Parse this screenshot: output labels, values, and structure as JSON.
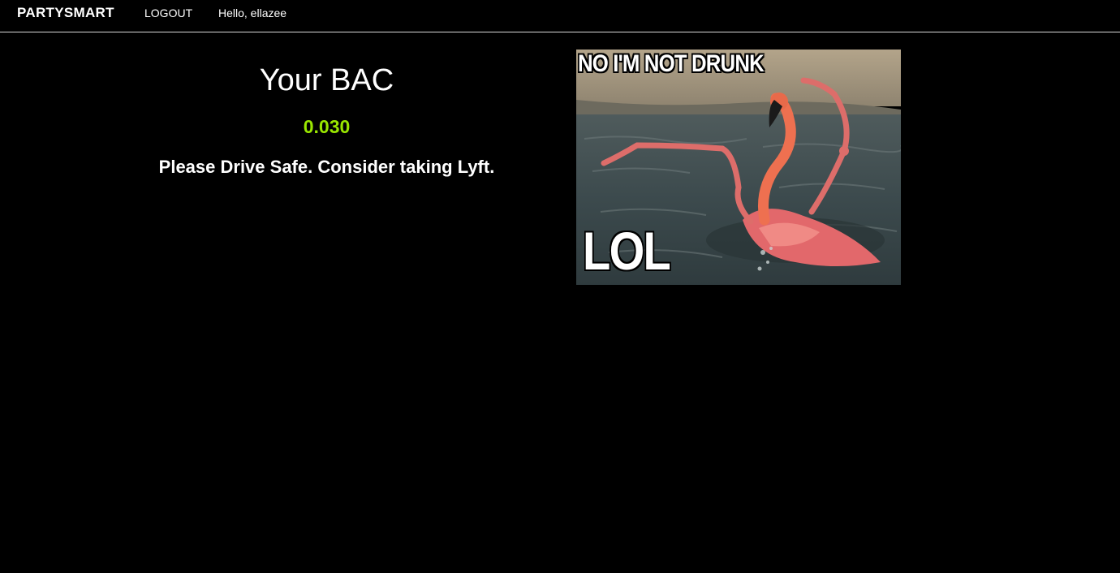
{
  "nav": {
    "brand": "PARTYSMART",
    "logout_label": "LOGOUT",
    "greeting": "Hello, ellazee"
  },
  "bac": {
    "title": "Your BAC",
    "value": "0.030",
    "message": "Please Drive Safe. Consider taking Lyft."
  },
  "meme": {
    "top_text": "NO I'M NOT DRUNK",
    "bottom_text": "LOL"
  },
  "colors": {
    "background": "#000000",
    "text": "#ffffff",
    "bac_value": "#99e600",
    "nav_border": "#d9d9d9"
  }
}
